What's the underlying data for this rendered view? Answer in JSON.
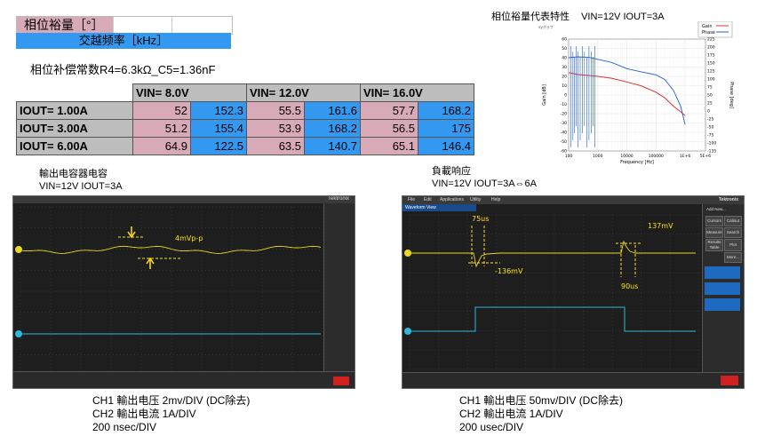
{
  "legend": {
    "phase_label": "相位裕量［°］",
    "freq_label": "交越频率［kHz］"
  },
  "compensation": "相位补偿常数R4=6.3kΩ_C5=1.36nF",
  "table": {
    "headers": [
      "",
      "VIN=  8.0V",
      "VIN= 12.0V",
      "VIN= 16.0V"
    ],
    "rows": [
      {
        "label": "IOUT= 1.00A",
        "vals": [
          "52",
          "152.3",
          "55.5",
          "161.6",
          "57.7",
          "168.2"
        ]
      },
      {
        "label": "IOUT= 3.00A",
        "vals": [
          "51.2",
          "155.4",
          "53.9",
          "168.2",
          "56.5",
          "175"
        ]
      },
      {
        "label": "IOUT= 6.00A",
        "vals": [
          "64.9",
          "122.5",
          "63.5",
          "140.7",
          "65.1",
          "146.4"
        ]
      }
    ]
  },
  "bode": {
    "title": "相位裕量代表特性",
    "cond": "VIN=12V IOUT=3A",
    "corner": "xyグラフ",
    "legend": [
      "Gain",
      "Phase"
    ],
    "xlabel": "Frequency [Hz]",
    "ylabel_left": "Gain [dB]",
    "ylabel_right": "Phase [deg]",
    "colors": {
      "gain": "#e03030",
      "phase": "#2060d0"
    }
  },
  "chart_data": {
    "type": "line",
    "title": "相位裕量代表特性",
    "xlabel": "Frequency [Hz]",
    "ylabel": "Gain [dB]",
    "x_scale": "log",
    "xlim": [
      100,
      1000000
    ],
    "ylim": [
      -60,
      60
    ],
    "y2lim": [
      -135,
      225
    ],
    "x_ticks": [
      "100",
      "1000",
      "10000",
      "100000",
      "1E+6",
      "5E+6"
    ],
    "y_ticks": [
      "60",
      "50",
      "40",
      "30",
      "20",
      "10",
      "0",
      "-10",
      "-20",
      "-30",
      "-40",
      "-50",
      "-60"
    ],
    "y2_ticks": [
      "225",
      "200",
      "175",
      "150",
      "125",
      "100",
      "75",
      "50",
      "25",
      "0",
      "-25",
      "-50",
      "-75",
      "-100",
      "-135"
    ],
    "series": [
      {
        "name": "Gain",
        "x": [
          100,
          200,
          500,
          1000,
          3000,
          10000,
          30000,
          100000,
          200000,
          400000,
          700000,
          1000000
        ],
        "values": [
          24,
          22,
          21,
          20,
          18,
          14,
          10,
          3,
          -3,
          -12,
          -18,
          -22
        ]
      },
      {
        "name": "Phase",
        "x": [
          100,
          200,
          500,
          1000,
          3000,
          10000,
          30000,
          100000,
          200000,
          400000,
          700000,
          1000000
        ],
        "values": [
          165,
          168,
          166,
          160,
          150,
          130,
          120,
          110,
          95,
          60,
          10,
          -50
        ]
      }
    ]
  },
  "scope1": {
    "title": "輸出电容器电容",
    "cond": "VIN=12V IOUT=3A",
    "brand": "Tektronix",
    "annotation": "4mVp-p",
    "captions": [
      "CH1 輸出电压 2mv/DIV (DC除去)",
      "CH2 輸出电流 1A/DIV",
      "200 nsec/DIV"
    ]
  },
  "scope2": {
    "title": "負載响应",
    "cond": "VIN=12V IOUT=3A⇔6A",
    "brand": "Tektronix",
    "menu": [
      "File",
      "Edit",
      "Applications",
      "Utility",
      "Help"
    ],
    "view": "Waveform View",
    "side_buttons": [
      "Add New...",
      "Cursors",
      "Callout",
      "Measure",
      "Search",
      "Results Table",
      "Plot",
      "More..."
    ],
    "ann": [
      "75us",
      "137mV",
      "-136mV",
      "90us"
    ],
    "captions": [
      "CH1 輸出电压 50mv/DIV (DC除去)",
      "CH2 輸出电流 1A/DIV",
      "200 usec/DIV"
    ]
  }
}
